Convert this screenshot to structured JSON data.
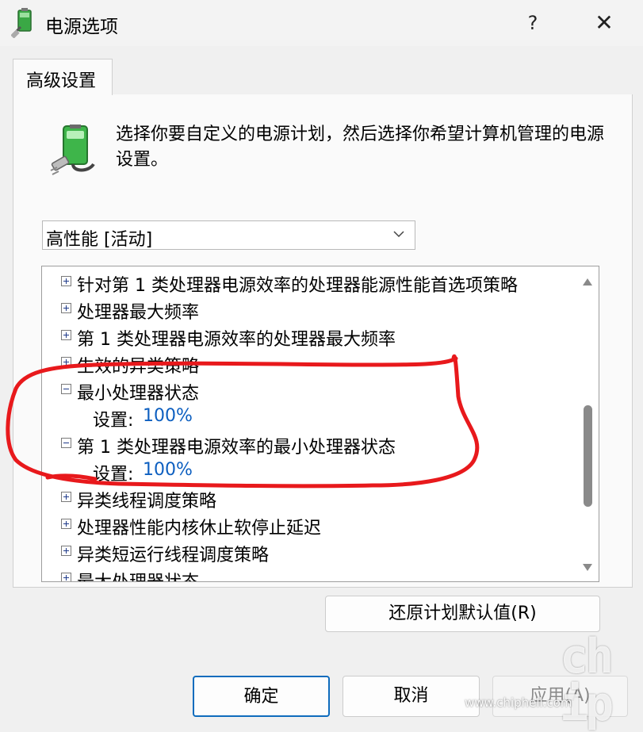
{
  "window": {
    "title": "电源选项",
    "help_label": "?",
    "close_label": "✕"
  },
  "tabs": [
    {
      "label": "高级设置"
    }
  ],
  "description": "选择你要自定义的电源计划，然后选择你希望计算机管理的电源设置。",
  "plan_select": {
    "value": "高性能 [活动]"
  },
  "tree": {
    "items": [
      {
        "label": "针对第 1 类处理器电源效率的处理器能源性能首选项策略",
        "expanded": false
      },
      {
        "label": "处理器最大频率",
        "expanded": false
      },
      {
        "label": "第 1 类处理器电源效率的处理器最大频率",
        "expanded": false
      },
      {
        "label": "生效的异类策略",
        "expanded": false
      },
      {
        "label": "最小处理器状态",
        "expanded": true,
        "setting_label": "设置:",
        "setting_value": "100%"
      },
      {
        "label": "第 1 类处理器电源效率的最小处理器状态",
        "expanded": true,
        "setting_label": "设置:",
        "setting_value": "100%"
      },
      {
        "label": "异类线程调度策略",
        "expanded": false
      },
      {
        "label": "处理器性能内核休止软停止延迟",
        "expanded": false
      },
      {
        "label": "异类短运行线程调度策略",
        "expanded": false
      },
      {
        "label": "最大处理器状态",
        "expanded": false
      }
    ]
  },
  "buttons": {
    "restore": "还原计划默认值(R)",
    "ok": "确定",
    "cancel": "取消",
    "apply": "应用(A)"
  },
  "annotation": {
    "color": "#e8191c"
  },
  "watermark": {
    "logo": "chip hell",
    "url": "www.chiphell.com"
  }
}
